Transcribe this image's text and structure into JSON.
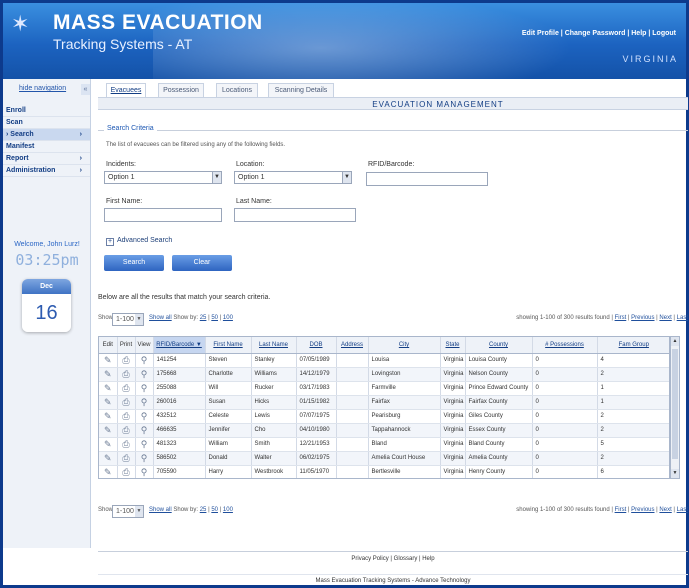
{
  "header": {
    "title_line1": "MASS EVACUATION",
    "title_line2": "Tracking Systems - AT",
    "links": [
      "Edit Profile",
      "Change Password",
      "Help",
      "Logout"
    ],
    "state": "VIRGINIA"
  },
  "sidebar": {
    "hide_nav": "hide navigation",
    "items": [
      {
        "label": "Enroll",
        "chev": ""
      },
      {
        "label": "Scan",
        "chev": ""
      },
      {
        "label": "Search",
        "chev": "›"
      },
      {
        "label": "Manifest",
        "chev": ""
      },
      {
        "label": "Report",
        "chev": "›"
      },
      {
        "label": "Administration",
        "chev": "›"
      }
    ],
    "welcome": "Welcome, John Lurz!",
    "time": "03:25pm",
    "cal_month": "Dec",
    "cal_day": "16"
  },
  "tabs": [
    "Evacuees",
    "Possession",
    "Locations",
    "Scanning Details"
  ],
  "page_title": "EVACUATION MANAGEMENT",
  "search": {
    "legend": "Search Criteria",
    "note": "The list of evacuees can be filtered using any of the following fields.",
    "incidents_label": "Incidents:",
    "incidents_value": "Option 1",
    "location_label": "Location:",
    "location_value": "Option 1",
    "rfid_label": "RFID/Barcode:",
    "first_name_label": "First Name:",
    "last_name_label": "Last Name:",
    "advanced": "Advanced Search",
    "search_btn": "Search",
    "clear_btn": "Clear"
  },
  "results": {
    "note": "Below are all the results that match your search criteria.",
    "show_label": "Show:",
    "show_value": "1-100",
    "show_all": "Show all",
    "show_by": "Show by:",
    "show_by_opts": [
      "25",
      "50",
      "100"
    ],
    "count_text": "showing 1-100 of 300 results found |",
    "nav": [
      "First",
      "Previous",
      "Next",
      "Last"
    ]
  },
  "table": {
    "headers": [
      "Edit",
      "Print",
      "View",
      "RFID/Barcode ▼",
      "First Name",
      "Last Name",
      "DOB",
      "Address",
      "City",
      "State",
      "County",
      "# Possessions",
      "Fam Group"
    ],
    "rows": [
      [
        "141254",
        "Steven",
        "Stanley",
        "07/05/1989",
        "",
        "Louisa",
        "Virginia",
        "Louisa County",
        "0",
        "4"
      ],
      [
        "175668",
        "Charlotte",
        "Williams",
        "14/12/1979",
        "",
        "Lovingston",
        "Virginia",
        "Nelson County",
        "0",
        "2"
      ],
      [
        "255088",
        "Will",
        "Rucker",
        "03/17/1983",
        "",
        "Farmville",
        "Virginia",
        "Prince Edward County",
        "0",
        "1"
      ],
      [
        "260016",
        "Susan",
        "Hicks",
        "01/15/1982",
        "",
        "Fairfax",
        "Virginia",
        "Fairfax County",
        "0",
        "1"
      ],
      [
        "432512",
        "Celeste",
        "Lewis",
        "07/07/1975",
        "",
        "Pearisburg",
        "Virginia",
        "Giles County",
        "0",
        "2"
      ],
      [
        "466635",
        "Jennifer",
        "Cho",
        "04/10/1980",
        "",
        "Tappahannock",
        "Virginia",
        "Essex County",
        "0",
        "2"
      ],
      [
        "481323",
        "William",
        "Smith",
        "12/21/1953",
        "",
        "Bland",
        "Virginia",
        "Bland County",
        "0",
        "5"
      ],
      [
        "586502",
        "Donald",
        "Walter",
        "06/02/1975",
        "",
        "Amelia Court House",
        "Virginia",
        "Amelia County",
        "0",
        "2"
      ],
      [
        "705590",
        "Harry",
        "Westbrook",
        "11/05/1970",
        "",
        "Bertlesville",
        "Virginia",
        "Henry County",
        "0",
        "6"
      ]
    ]
  },
  "footer": {
    "links": "Privacy Policy | Glossary | Help",
    "copyright": "Mass Evacuation Tracking Systems - Advance Technology"
  }
}
